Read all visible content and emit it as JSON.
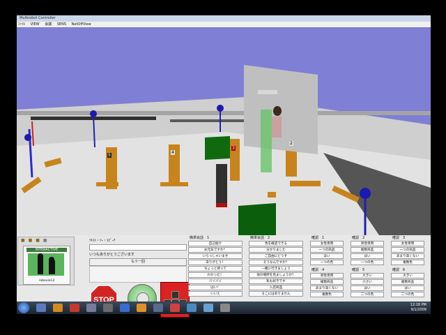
{
  "window": {
    "title": "Multirobot Controller"
  },
  "menu": [
    "ﾌｧｲﾙ",
    "VIEW",
    "会議",
    "SENS",
    "NetOffView"
  ],
  "left_panel": {
    "mode": "INTERACTIVE",
    "robot_name": "robovie13"
  },
  "tts": {
    "label": "ﾃｷｽﾄ・ﾂｰ・ｽﾋﾟｰﾁ",
    "input_value": "",
    "label2": "いつもありがとうございます",
    "repeat_button": "もう一回"
  },
  "buttons": {
    "stop": "STOP"
  },
  "columns": [
    {
      "header": "簡単会話　1",
      "items": [
        "自己紹介",
        "お元気ですか？",
        "いらっしゃいませ",
        "ありがとう！",
        "ちょっと待って",
        "わかった！",
        "バイバイ",
        "はい！",
        "いいえ"
      ]
    },
    {
      "header": "簡単会話　2",
      "items": [
        "色を確認できる",
        "分かりました",
        "ご自由にどうぞ",
        "そうなんですか？",
        "一緒に行きましょう",
        "他の場所を見ましょうか？",
        "私も好きです",
        "入店商品",
        "そこにはありません"
      ]
    },
    {
      "header": "確認　1",
      "items": [
        "女性専用",
        "一つの商品",
        "はい",
        "一つの色"
      ]
    },
    {
      "header": "確認　2",
      "items": [
        "男性専用",
        "複数商品",
        "はい",
        "一つの色"
      ]
    },
    {
      "header": "確認　3",
      "items": [
        "女性専用",
        "一つの商品",
        "あまり高くない",
        "複数色"
      ]
    },
    {
      "header": "確認　4",
      "items": [
        "男性専用",
        "複数商品",
        "あまり高くない",
        "複数色"
      ]
    },
    {
      "header": "確認　5",
      "items": [
        "大きい",
        "小さい",
        "はい",
        "二つの色"
      ]
    },
    {
      "header": "確認　6",
      "items": [
        "大きい",
        "複数商品",
        "はい",
        "二つの色"
      ]
    }
  ],
  "scene": {
    "markers": [
      "5",
      "4",
      "3",
      "2"
    ]
  },
  "clock": {
    "time": "12:18 PM",
    "date": "9/1/2009"
  },
  "colors": {
    "floor": "#e2e2e2",
    "sky": "#7f7fd6",
    "pillar": "#c8841c",
    "stop": "#d32222"
  }
}
